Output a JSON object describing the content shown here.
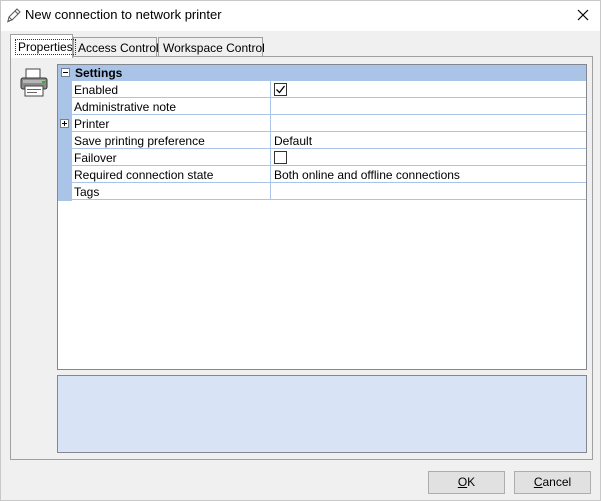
{
  "window": {
    "title": "New connection to network printer",
    "title_icon": "pen-icon",
    "close_icon": "close-icon"
  },
  "tabs": [
    {
      "label": "Properties",
      "active": true
    },
    {
      "label": "Access Control",
      "active": false
    },
    {
      "label": "Workspace Control",
      "active": false
    }
  ],
  "panel": {
    "icon": "printer-icon"
  },
  "grid": {
    "category": "Settings",
    "rows": [
      {
        "name": "Enabled",
        "value": "",
        "checkbox": true,
        "checked": true
      },
      {
        "name": "Administrative note",
        "value": ""
      },
      {
        "name": "Printer",
        "value": "",
        "expandable": true
      },
      {
        "name": "Save printing preference",
        "value": "Default"
      },
      {
        "name": "Failover",
        "value": "",
        "checkbox": true,
        "checked": false
      },
      {
        "name": "Required connection state",
        "value": "Both online and offline connections"
      },
      {
        "name": "Tags",
        "value": ""
      }
    ]
  },
  "buttons": {
    "ok_label": "OK",
    "ok_mnemonic": "O",
    "ok_rest": "K",
    "cancel_label": "Cancel",
    "cancel_mnemonic": "C",
    "cancel_rest": "ancel"
  },
  "colors": {
    "grid_line": "#a9c4e7",
    "help_panel": "#d8e4f6"
  }
}
